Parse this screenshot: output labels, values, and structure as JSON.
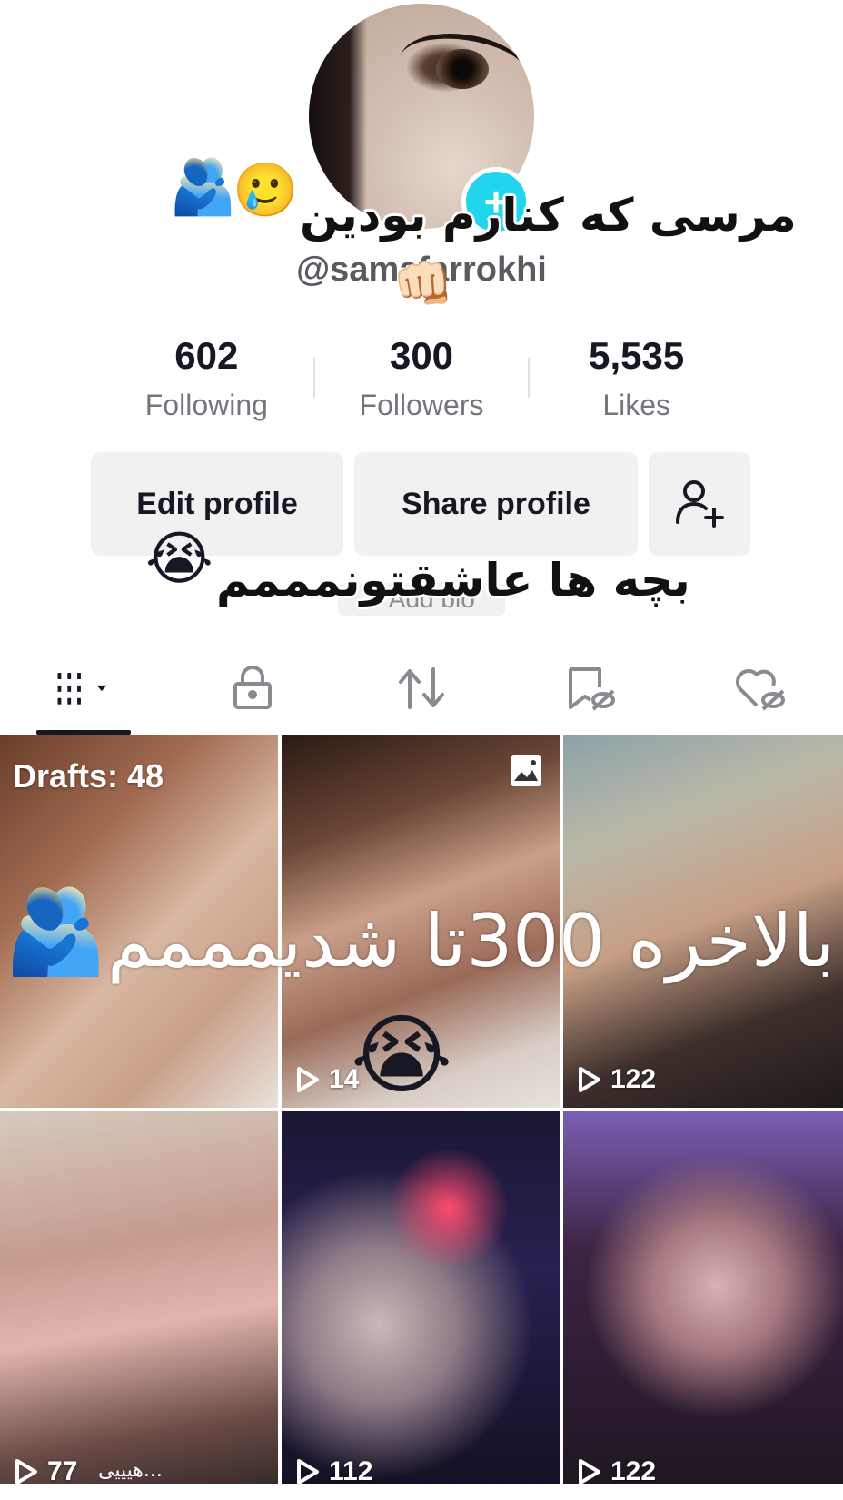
{
  "profile": {
    "username": "@samafarrokhi",
    "stats": [
      {
        "value": "602",
        "label": "Following"
      },
      {
        "value": "300",
        "label": "Followers"
      },
      {
        "value": "5,535",
        "label": "Likes"
      }
    ]
  },
  "buttons": {
    "edit_profile": "Edit profile",
    "share_profile": "Share profile"
  },
  "add_bio": "+ Add bio",
  "overlay": {
    "caption_top": "مرسی که کنارم بودین",
    "caption_mid": "بچه ها عاشقتونمممم",
    "caption_grid": "بالاخره 300تا شدیمممم"
  },
  "emoji": {
    "hug": "🫂",
    "smile_tear": "🥲",
    "fist": "👊🏻",
    "cry": "😭"
  },
  "grid": {
    "drafts": "Drafts: 48",
    "items": [
      {
        "views": "14"
      },
      {
        "views": "122"
      },
      {
        "views": "77"
      },
      {
        "views": "112"
      },
      {
        "views": "122"
      }
    ],
    "handwriting": "هیییی..."
  },
  "colors": {
    "accent": "#20d5ec",
    "button_bg": "#f1f1f2",
    "text_primary": "#161823",
    "text_secondary": "#75757d"
  }
}
